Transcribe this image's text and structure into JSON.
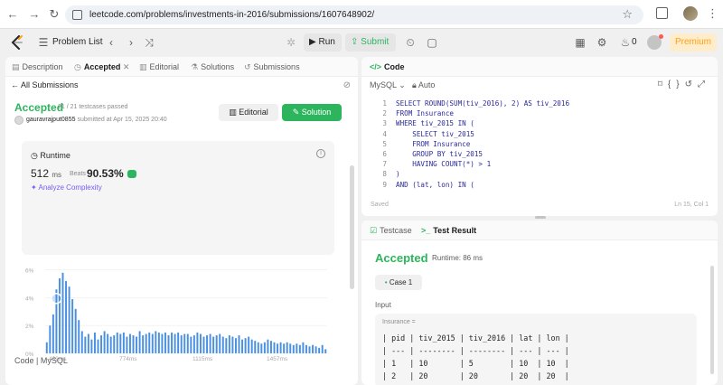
{
  "browser": {
    "url": "leetcode.com/problems/investments-in-2016/submissions/1607648902/"
  },
  "topbar": {
    "problem_list": "Problem List",
    "run": "Run",
    "submit": "Submit",
    "coins": "0",
    "premium": "Premium"
  },
  "left_tabs": [
    {
      "label": "Description",
      "icon": "document-icon"
    },
    {
      "label": "Accepted",
      "icon": "clock-icon"
    },
    {
      "label": "Editorial",
      "icon": "book-icon"
    },
    {
      "label": "Solutions",
      "icon": "flask-icon"
    },
    {
      "label": "Submissions",
      "icon": "history-icon"
    }
  ],
  "submission": {
    "back": "All Submissions",
    "status": "Accepted",
    "testcases": "21 / 21 testcases passed",
    "user": "gauravrajput0855",
    "submitted": "submitted at Apr 15, 2025 20:40",
    "editorial_btn": "Editorial",
    "solution_btn": "Solution"
  },
  "runtime": {
    "label": "Runtime",
    "value": "512",
    "unit": "ms",
    "beats_label": "Beats",
    "beats": "90.53%",
    "analyze": "Analyze Complexity"
  },
  "chart_data": {
    "type": "bar",
    "y_ticks": [
      "0%",
      "2%",
      "4%",
      "6%"
    ],
    "ylim": [
      0,
      6.5
    ],
    "x_tick_labels": [
      "432ms",
      "774ms",
      "1115ms",
      "1457ms"
    ],
    "highlight_index": 3,
    "values": [
      0.8,
      2.0,
      2.8,
      4.6,
      5.4,
      5.8,
      5.2,
      4.8,
      3.9,
      3.2,
      2.4,
      1.6,
      1.2,
      1.4,
      1.0,
      1.5,
      1.0,
      1.3,
      1.6,
      1.4,
      1.2,
      1.3,
      1.5,
      1.4,
      1.5,
      1.2,
      1.4,
      1.3,
      1.2,
      1.6,
      1.3,
      1.4,
      1.5,
      1.4,
      1.6,
      1.5,
      1.4,
      1.5,
      1.3,
      1.5,
      1.4,
      1.5,
      1.3,
      1.4,
      1.4,
      1.2,
      1.3,
      1.5,
      1.4,
      1.2,
      1.3,
      1.4,
      1.2,
      1.3,
      1.4,
      1.2,
      1.1,
      1.3,
      1.2,
      1.1,
      1.3,
      1.0,
      1.1,
      1.2,
      1.0,
      0.9,
      0.8,
      0.7,
      0.8,
      1.0,
      0.9,
      0.8,
      0.7,
      0.8,
      0.7,
      0.8,
      0.7,
      0.6,
      0.7,
      0.6,
      0.8,
      0.6,
      0.5,
      0.6,
      0.5,
      0.4,
      0.6,
      0.3
    ],
    "bar_color": "#4a90e2"
  },
  "code_section_label": "Code | MySQL",
  "editor": {
    "tab": "Code",
    "language": "MySQL",
    "mode": "Auto",
    "lines": [
      "SELECT ROUND(SUM(tiv_2016), 2) AS tiv_2016",
      "FROM Insurance",
      "WHERE tiv_2015 IN (",
      "    SELECT tiv_2015",
      "    FROM Insurance",
      "    GROUP BY tiv_2015",
      "    HAVING COUNT(*) > 1",
      ")",
      "AND (lat, lon) IN ("
    ],
    "saved": "Saved",
    "position": "Ln 15, Col 1"
  },
  "result": {
    "tab_testcase": "Testcase",
    "tab_result": "Test Result",
    "status": "Accepted",
    "runtime": "Runtime: 86 ms",
    "case": "Case 1",
    "input_label": "Input",
    "input_var": "Insurance =",
    "table_lines": [
      "| pid | tiv_2015 | tiv_2016 | lat | lon |",
      "| --- | -------- | -------- | --- | --- |",
      "| 1   | 10       | 5        | 10  | 10  |",
      "| 2   | 20       | 20       | 20  | 20  |"
    ]
  },
  "colors": {
    "accent_green": "#2db55d",
    "premium": "#ffa116",
    "bar": "#4a90e2"
  }
}
